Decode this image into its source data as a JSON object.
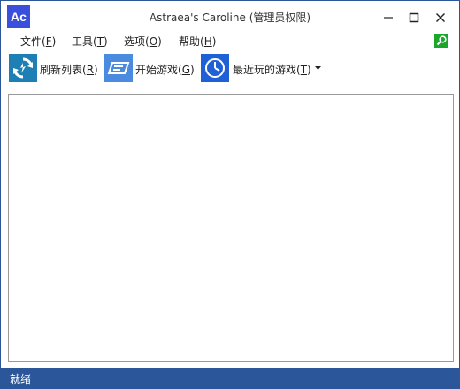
{
  "window": {
    "logo_text": "Ac",
    "title": "Astraea's Caroline (管理员权限)",
    "controls": [
      "minimize-icon",
      "maximize-icon",
      "close-icon"
    ]
  },
  "menu": {
    "items": [
      {
        "label": "文件(",
        "mnemonic": "F",
        "suffix": ")"
      },
      {
        "label": "工具(",
        "mnemonic": "T",
        "suffix": ")"
      },
      {
        "label": "选项(",
        "mnemonic": "O",
        "suffix": ")"
      },
      {
        "label": "帮助(",
        "mnemonic": "H",
        "suffix": ")"
      }
    ],
    "search_icon": "search-icon"
  },
  "toolbar": {
    "refresh": {
      "label": "刷新列表(",
      "mnemonic": "R",
      "suffix": ")",
      "icon": "refresh-icon"
    },
    "start": {
      "label": "开始游戏(",
      "mnemonic": "G",
      "suffix": ")",
      "icon": "play-icon"
    },
    "recent": {
      "label": "最近玩的游戏(",
      "mnemonic": "T",
      "suffix": ")",
      "icon": "clock-icon"
    }
  },
  "status": {
    "text": "就绪"
  },
  "colors": {
    "accent": "#2b579a",
    "logo": "#3a4fdb",
    "refresh_icon": "#1e7fb4",
    "start_icon": "#4a8adf",
    "recent_icon": "#2060d6",
    "search_icon": "#1aa62a"
  }
}
